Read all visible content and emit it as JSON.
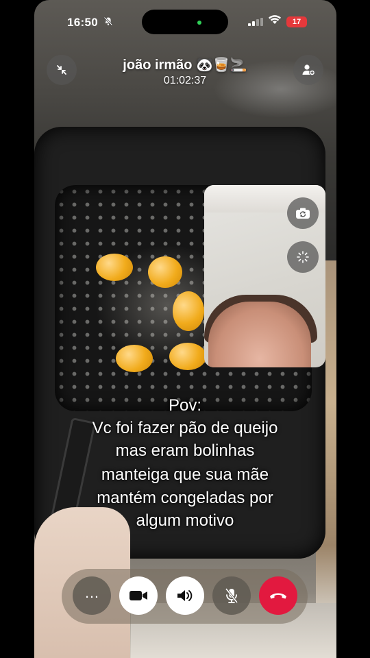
{
  "status_bar": {
    "time": "16:50",
    "battery": "17",
    "icons": [
      "bell-slash-icon",
      "signal-icon",
      "wifi-icon",
      "battery-icon"
    ]
  },
  "call": {
    "name": "joão irmão 🐼🥃🚬",
    "duration": "01:02:37"
  },
  "caption": {
    "lines": [
      "Pov:",
      "Vc foi fazer pão de queijo",
      "mas eram bolinhas",
      "manteiga que sua mãe",
      "mantém congeladas por",
      "algum motivo"
    ]
  },
  "controls": {
    "more_icon": "…",
    "buttons": [
      "more-button",
      "video-button",
      "speaker-button",
      "mute-button",
      "end-call-button"
    ]
  },
  "colors": {
    "end_call": "#e2193f",
    "battery": "#e5383b",
    "active_button": "#ffffff"
  }
}
